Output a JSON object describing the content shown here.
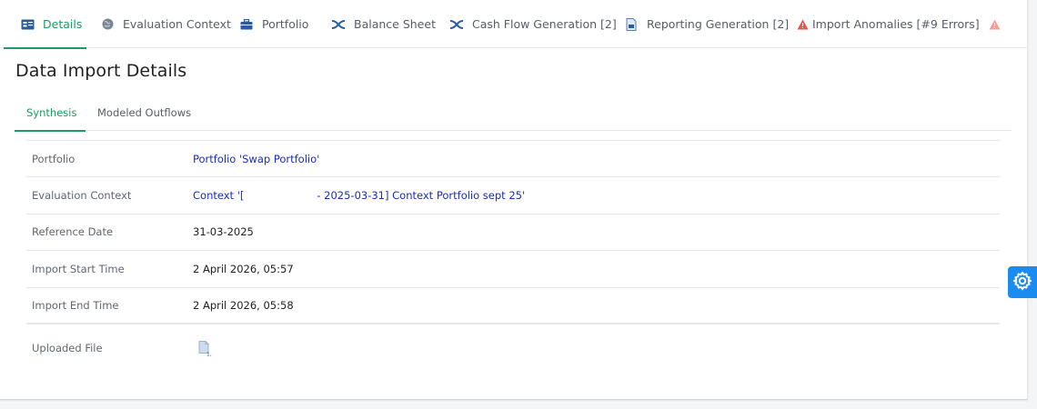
{
  "tabs": [
    {
      "label": "Details",
      "icon": "id-card-icon",
      "active": true
    },
    {
      "label": "Evaluation Context",
      "icon": "globe-icon",
      "active": false
    },
    {
      "label": "Portfolio",
      "icon": "briefcase-icon",
      "active": false
    },
    {
      "label": "Balance Sheet",
      "icon": "balance-sheet-icon",
      "active": false
    },
    {
      "label": "Cash Flow Generation [2]",
      "icon": "cash-flow-icon",
      "active": false
    },
    {
      "label": "Reporting Generation [2]",
      "icon": "report-file-icon",
      "active": false
    },
    {
      "label": "Import Anomalies [#9 Errors]",
      "icon": "warning-icon",
      "active": false
    }
  ],
  "page": {
    "title": "Data Import Details"
  },
  "subtabs": [
    {
      "label": "Synthesis",
      "active": true
    },
    {
      "label": "Modeled Outflows",
      "active": false
    }
  ],
  "details": {
    "portfolio": {
      "label": "Portfolio",
      "value": "Portfolio 'Swap Portfolio'"
    },
    "evaluation_context": {
      "label": "Evaluation Context",
      "value_prefix": "Context '[",
      "value_suffix": "- 2025-03-31] Context Portfolio sept 25'"
    },
    "reference_date": {
      "label": "Reference Date",
      "value": "31-03-2025"
    },
    "import_start": {
      "label": "Import Start Time",
      "value": "2 April 2026, 05:57"
    },
    "import_end": {
      "label": "Import End Time",
      "value": "2 April 2026, 05:58"
    },
    "uploaded_file": {
      "label": "Uploaded File",
      "icon": "file-icon"
    }
  },
  "colors": {
    "accent": "#1e9b64",
    "link": "#1a2dbf",
    "warning": "#e8574a",
    "gear": "#1a8cf0"
  }
}
